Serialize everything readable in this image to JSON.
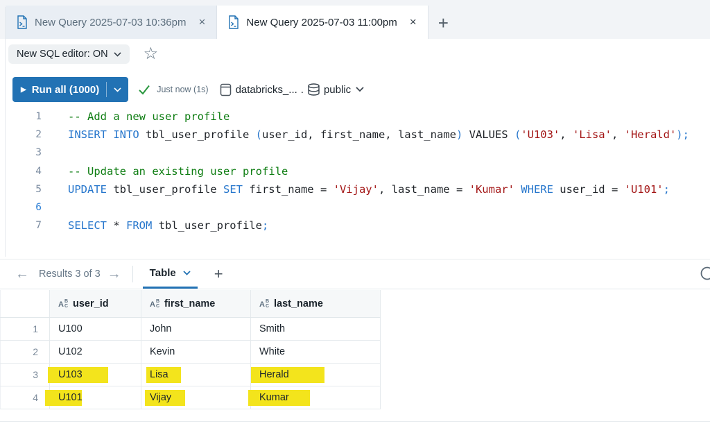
{
  "tabs": {
    "items": [
      {
        "label": "New Query 2025-07-03 10:36pm",
        "close": "×",
        "active": false
      },
      {
        "label": "New Query 2025-07-03 11:00pm",
        "close": "×",
        "active": true
      }
    ],
    "new_tab": "+"
  },
  "editor_toolbar": {
    "sql_editor_toggle": "New SQL editor: ON",
    "star_icon": "☆",
    "run_button": "Run all  (1000)",
    "play_icon": "▶",
    "last_run": "Just now (1s)",
    "catalog": "databricks_...",
    "separator": ".",
    "schema": "public"
  },
  "code": {
    "lines": [
      {
        "num": "1",
        "segments": [
          {
            "t": "-- Add a new user profile",
            "c": "com"
          }
        ]
      },
      {
        "num": "2",
        "segments": [
          {
            "t": "INSERT INTO",
            "c": "kw"
          },
          {
            "t": " tbl_user_profile ",
            "c": "id"
          },
          {
            "t": "(",
            "c": "pb"
          },
          {
            "t": "user_id, first_name, last_name",
            "c": "id"
          },
          {
            "t": ")",
            "c": "pb"
          },
          {
            "t": " VALUES ",
            "c": "id"
          },
          {
            "t": "(",
            "c": "pb"
          },
          {
            "t": "'U103'",
            "c": "str"
          },
          {
            "t": ", ",
            "c": "id"
          },
          {
            "t": "'Lisa'",
            "c": "str"
          },
          {
            "t": ", ",
            "c": "id"
          },
          {
            "t": "'Herald'",
            "c": "str"
          },
          {
            "t": ");",
            "c": "pb"
          }
        ]
      },
      {
        "num": "3",
        "segments": []
      },
      {
        "num": "4",
        "segments": [
          {
            "t": "-- Update an existing user profile",
            "c": "com"
          }
        ]
      },
      {
        "num": "5",
        "segments": [
          {
            "t": "UPDATE",
            "c": "kw"
          },
          {
            "t": " tbl_user_profile ",
            "c": "id"
          },
          {
            "t": "SET",
            "c": "kw"
          },
          {
            "t": " first_name = ",
            "c": "id"
          },
          {
            "t": "'Vijay'",
            "c": "str"
          },
          {
            "t": ", last_name = ",
            "c": "id"
          },
          {
            "t": "'Kumar'",
            "c": "str"
          },
          {
            "t": " ",
            "c": "id"
          },
          {
            "t": "WHERE",
            "c": "kw"
          },
          {
            "t": " user_id = ",
            "c": "id"
          },
          {
            "t": "'U101'",
            "c": "str"
          },
          {
            "t": ";",
            "c": "pb"
          }
        ]
      },
      {
        "num": "6",
        "segments": [],
        "active": true
      },
      {
        "num": "7",
        "segments": [
          {
            "t": "SELECT",
            "c": "kw"
          },
          {
            "t": " * ",
            "c": "id"
          },
          {
            "t": "FROM",
            "c": "kw"
          },
          {
            "t": " tbl_user_profile",
            "c": "id"
          },
          {
            "t": ";",
            "c": "pb"
          }
        ]
      }
    ]
  },
  "results_bar": {
    "label": "Results 3 of 3",
    "prev_icon": "←",
    "next_icon": "→",
    "tab": "Table",
    "add": "+"
  },
  "table": {
    "columns": [
      "user_id",
      "first_name",
      "last_name"
    ],
    "rows": [
      {
        "num": "1",
        "cells": [
          {
            "v": "U100"
          },
          {
            "v": "John"
          },
          {
            "v": "Smith"
          }
        ]
      },
      {
        "num": "2",
        "cells": [
          {
            "v": "U102"
          },
          {
            "v": "Kevin"
          },
          {
            "v": "White"
          }
        ]
      },
      {
        "num": "3",
        "cells": [
          {
            "v": "U103",
            "hl": true,
            "hlx": -15,
            "hlw": 87
          },
          {
            "v": "Lisa",
            "hl": true,
            "hlx": -5,
            "hlw": 50
          },
          {
            "v": "Herald",
            "hl": true,
            "hlx": -12,
            "hlw": 106
          }
        ]
      },
      {
        "num": "4",
        "cells": [
          {
            "v": "U101",
            "hl": true,
            "hlx": -19,
            "hlw": 53
          },
          {
            "v": "Vijay",
            "hl": true,
            "hlx": -7,
            "hlw": 58
          },
          {
            "v": "Kumar",
            "hl": true,
            "hlx": -16,
            "hlw": 89
          }
        ]
      }
    ]
  },
  "colors": {
    "accent": "#2272b4",
    "keyword": "#2676cc",
    "comment": "#0e7d12",
    "string": "#a31515",
    "highlight": "#f3e41c",
    "success": "#27963c"
  }
}
